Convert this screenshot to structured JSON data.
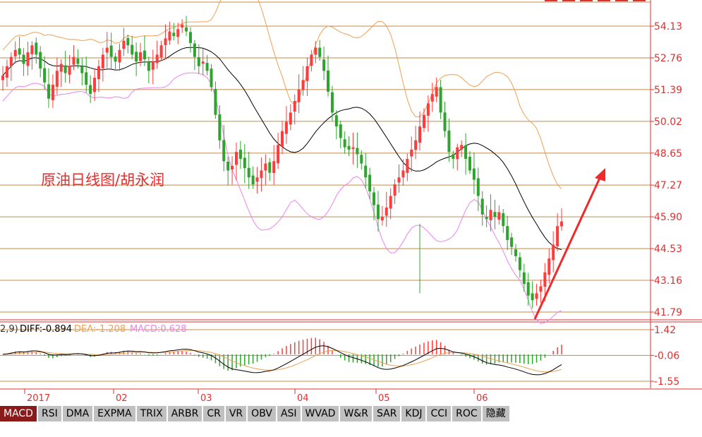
{
  "colors": {
    "grid": "#c08a4a",
    "up": "#ff3b3b",
    "down": "#2ea42e",
    "ma": "#000000",
    "upper_band": "#f0a050",
    "lower_band": "#ee82ee",
    "axis_text": "#e03030",
    "arrow": "#ee2a2a"
  },
  "annotation": "原油日线图/胡永润",
  "indicator": {
    "params": "2,9)",
    "diff_label": "DIFF:-0.894",
    "dea_label": "DEA:-1.208",
    "macd_label": "MACD:0.628",
    "ticks": [
      "1.42",
      "-0.06",
      "-1.55"
    ]
  },
  "x_labels": [
    "2017",
    "02",
    "03",
    "04",
    "05",
    "06"
  ],
  "tabs": [
    "MACD",
    "RSI",
    "DMA",
    "EXPMA",
    "TRIX",
    "ARBR",
    "CR",
    "VR",
    "OBV",
    "ASI",
    "WVAD",
    "W&R",
    "SAR",
    "KDJ",
    "CCI",
    "ROC",
    "隐藏"
  ],
  "active_tab": "MACD",
  "chart_data": {
    "type": "candlestick",
    "price_ticks": [
      54.13,
      52.76,
      51.39,
      50.02,
      48.65,
      47.27,
      45.9,
      44.53,
      43.16,
      41.79
    ],
    "ylim": [
      41.79,
      54.13
    ],
    "trend_arrow": true,
    "close_path": [
      52.0,
      52.4,
      52.8,
      53.1,
      52.9,
      52.5,
      53.0,
      53.3,
      52.9,
      52.3,
      51.7,
      51.0,
      51.6,
      52.2,
      52.5,
      52.1,
      52.4,
      52.8,
      52.5,
      52.1,
      51.6,
      51.2,
      51.9,
      52.4,
      52.9,
      53.2,
      52.8,
      52.6,
      53.1,
      53.5,
      53.3,
      52.9,
      52.6,
      53.0,
      52.7,
      52.2,
      52.6,
      52.9,
      53.3,
      53.6,
      53.9,
      53.7,
      54.0,
      54.2,
      53.9,
      53.4,
      52.8,
      52.4,
      52.6,
      52.2,
      51.5,
      50.3,
      49.2,
      48.3,
      47.9,
      48.1,
      48.7,
      48.4,
      48.0,
      47.6,
      47.3,
      47.6,
      47.9,
      48.2,
      47.8,
      48.3,
      49.0,
      49.6,
      50.0,
      50.4,
      50.9,
      51.4,
      51.8,
      52.4,
      52.9,
      53.2,
      52.8,
      52.2,
      51.3,
      50.4,
      49.8,
      49.3,
      48.9,
      48.8,
      48.9,
      48.6,
      48.2,
      47.6,
      47.0,
      46.4,
      45.8,
      45.9,
      46.3,
      46.8,
      47.3,
      47.6,
      47.9,
      48.4,
      48.8,
      49.2,
      49.8,
      50.3,
      50.8,
      51.2,
      51.5,
      50.4,
      49.6,
      48.7,
      48.4,
      48.9,
      49.0,
      48.4,
      47.9,
      47.5,
      46.8,
      46.0,
      45.8,
      46.2,
      45.9,
      46.1,
      45.5,
      44.9,
      44.6,
      44.2,
      43.6,
      43.0,
      42.5,
      42.3,
      42.6,
      42.9,
      43.5,
      44.1,
      44.7,
      45.5,
      45.7
    ]
  }
}
